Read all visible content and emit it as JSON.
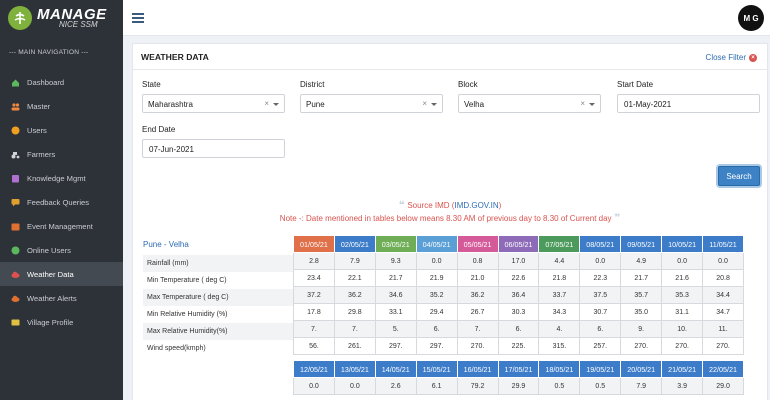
{
  "app": {
    "logo_line1": "MANAGE",
    "logo_line2": "NICE SSM",
    "user_initials": "M G"
  },
  "sidebar": {
    "heading": "--- MAIN NAVIGATION ---",
    "items": [
      {
        "label": "Dashboard",
        "icon": "home-icon",
        "color": "#5cb85c"
      },
      {
        "label": "Master",
        "icon": "users-icon",
        "color": "#f0883e"
      },
      {
        "label": "Users",
        "icon": "user-circle-icon",
        "color": "#f0a020"
      },
      {
        "label": "Farmers",
        "icon": "tractor-icon",
        "color": "#d0d2d6"
      },
      {
        "label": "Knowledge Mgmt",
        "icon": "book-icon",
        "color": "#b070d0"
      },
      {
        "label": "Feedback Queries",
        "icon": "chat-icon",
        "color": "#e0a030"
      },
      {
        "label": "Event Management",
        "icon": "calendar-icon",
        "color": "#e07030"
      },
      {
        "label": "Online Users",
        "icon": "globe-icon",
        "color": "#5cb85c"
      },
      {
        "label": "Weather Data",
        "icon": "cloud-icon",
        "color": "#e05050",
        "active": true
      },
      {
        "label": "Weather Alerts",
        "icon": "cloud-alert-icon",
        "color": "#e07030"
      },
      {
        "label": "Village Profile",
        "icon": "map-icon",
        "color": "#e0c040"
      }
    ]
  },
  "card": {
    "title": "WEATHER DATA",
    "close_filter": "Close Filter"
  },
  "filters": {
    "state_label": "State",
    "state_value": "Maharashtra",
    "district_label": "District",
    "district_value": "Pune",
    "block_label": "Block",
    "block_value": "Velha",
    "start_label": "Start Date",
    "start_value": "01-May-2021",
    "end_label": "End Date",
    "end_value": "07-Jun-2021",
    "search_label": "Search"
  },
  "notes": {
    "source_prefix": "Source IMD (",
    "source_link": "IMD.GOV.IN",
    "source_suffix": ")",
    "note": "Note -: Date mentioned in tables below means 8.30 AM of previous day to 8.30 of Current day"
  },
  "table": {
    "location": "Pune - Velha",
    "row_labels": [
      "Rainfall (mm)",
      "Min Temperature ( deg C)",
      "Max Temperature ( deg C)",
      "Min Relative Humidity (%)",
      "Max Relative Humidity(%)",
      "Wind speed(kmph)"
    ],
    "block1": {
      "dates": [
        "01/05/21",
        "02/05/21",
        "03/05/21",
        "04/05/21",
        "05/05/21",
        "06/05/21",
        "07/05/21",
        "08/05/21",
        "09/05/21",
        "10/05/21",
        "11/05/21"
      ],
      "colors": [
        "#e0704a",
        "#3d7cc9",
        "#6fae57",
        "#5a9fd6",
        "#d55a9a",
        "#8e6bb8",
        "#4c9b5c",
        "#3d7cc9",
        "#3d7cc9",
        "#3d7cc9",
        "#3d7cc9"
      ],
      "rows": [
        [
          "2.8",
          "7.9",
          "9.3",
          "0.0",
          "0.8",
          "17.0",
          "4.4",
          "0.0",
          "4.9",
          "0.0",
          "0.0"
        ],
        [
          "23.4",
          "22.1",
          "21.7",
          "21.9",
          "21.0",
          "22.6",
          "21.8",
          "22.3",
          "21.7",
          "21.6",
          "20.8"
        ],
        [
          "37.2",
          "36.2",
          "34.6",
          "35.2",
          "36.2",
          "36.4",
          "33.7",
          "37.5",
          "35.7",
          "35.3",
          "34.4"
        ],
        [
          "17.8",
          "29.8",
          "33.1",
          "29.4",
          "26.7",
          "30.3",
          "34.3",
          "30.7",
          "35.0",
          "31.1",
          "34.7"
        ],
        [
          "7.",
          "7.",
          "5.",
          "6.",
          "7.",
          "6.",
          "4.",
          "6.",
          "9.",
          "10.",
          "11."
        ],
        [
          "56.",
          "261.",
          "297.",
          "297.",
          "270.",
          "225.",
          "315.",
          "257.",
          "270.",
          "270.",
          "270."
        ]
      ]
    },
    "block2": {
      "dates": [
        "12/05/21",
        "13/05/21",
        "14/05/21",
        "15/05/21",
        "16/05/21",
        "17/05/21",
        "18/05/21",
        "19/05/21",
        "20/05/21",
        "21/05/21",
        "22/05/21"
      ],
      "color": "#3d7cc9",
      "rows": [
        [
          "0.0",
          "0.0",
          "2.6",
          "6.1",
          "79.2",
          "29.9",
          "0.5",
          "0.5",
          "7.9",
          "3.9",
          "29.0"
        ]
      ]
    }
  }
}
